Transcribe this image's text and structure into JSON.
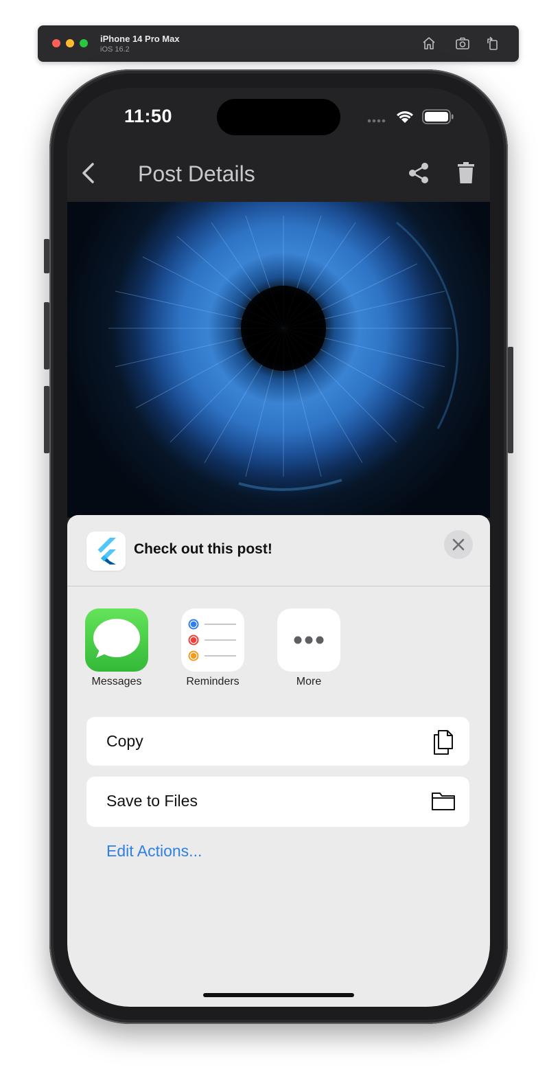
{
  "simulator": {
    "device_name": "iPhone 14 Pro Max",
    "os_version": "iOS 16.2"
  },
  "status_bar": {
    "time": "11:50"
  },
  "app_bar": {
    "title": "Post Details"
  },
  "share_sheet": {
    "title": "Check out this post!",
    "apps": [
      {
        "label": "Messages",
        "icon": "messages-icon"
      },
      {
        "label": "Reminders",
        "icon": "reminders-icon"
      },
      {
        "label": "More",
        "icon": "more-icon"
      }
    ],
    "actions": [
      {
        "label": "Copy",
        "icon": "copy-icon"
      },
      {
        "label": "Save to Files",
        "icon": "folder-icon"
      }
    ],
    "edit_actions_label": "Edit Actions..."
  },
  "colors": {
    "accent": "#2f80e3",
    "app_bar_bg": "#232326",
    "sheet_bg": "#ebebeb",
    "messages_green": "#4cd964"
  }
}
